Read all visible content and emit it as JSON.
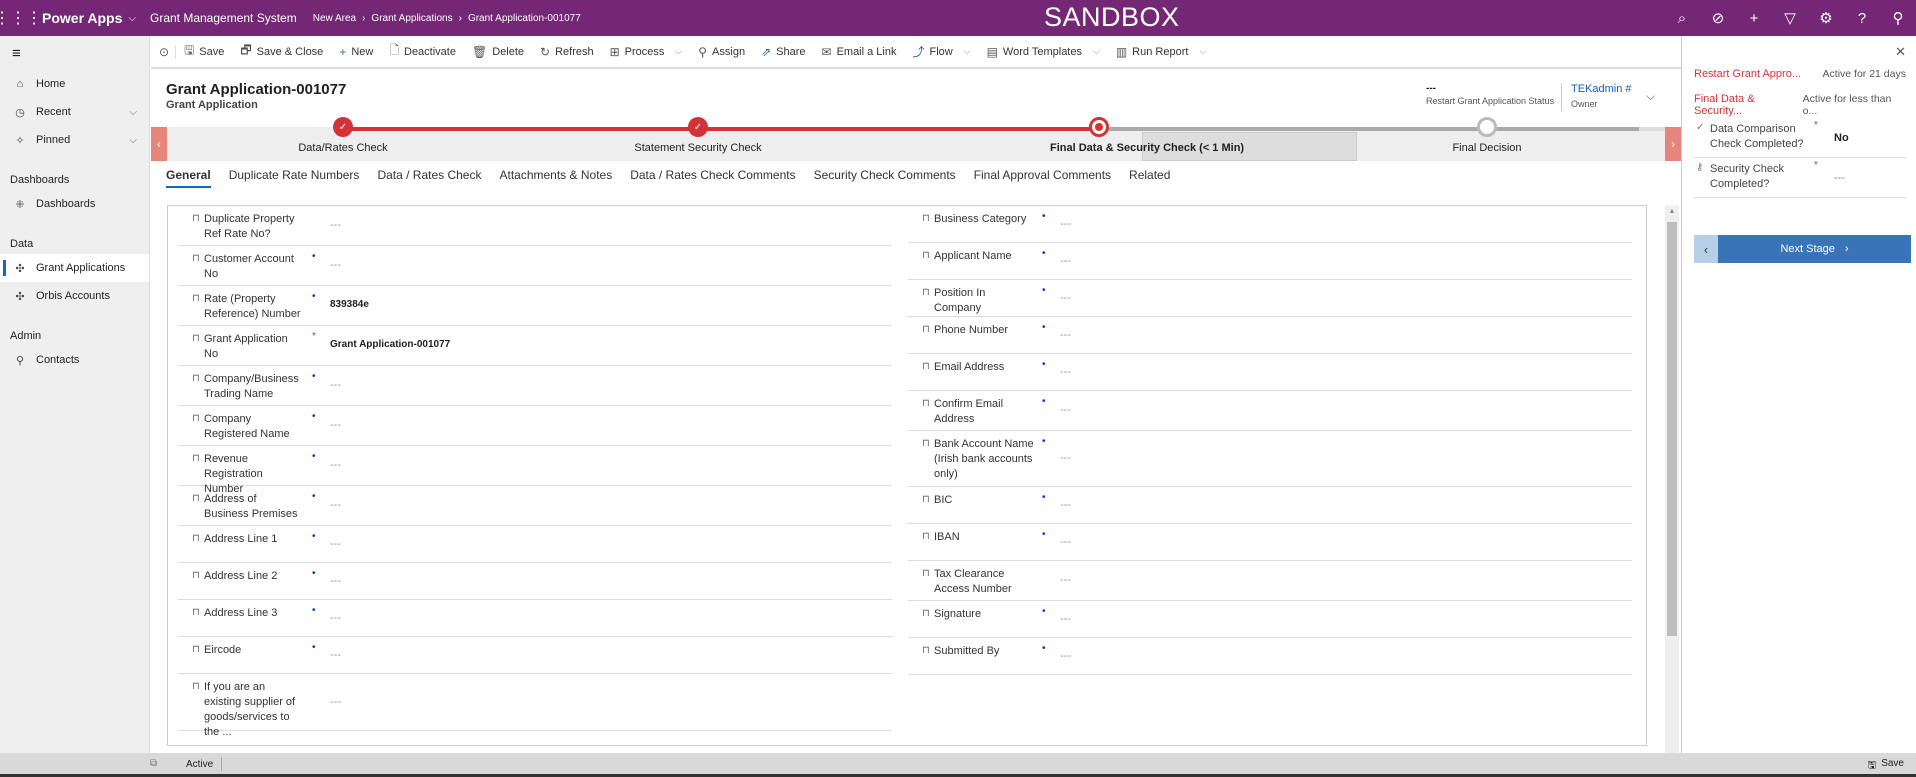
{
  "topbar": {
    "app_name": "Power Apps",
    "system_name": "Grant Management System",
    "breadcrumb": [
      "New Area",
      "Grant Applications",
      "Grant Application-001077"
    ],
    "environment_banner": "SANDBOX",
    "icons": [
      "search-icon",
      "assistant-icon",
      "add-icon",
      "filter-icon",
      "settings-icon",
      "help-icon",
      "user-icon"
    ]
  },
  "sidebar": {
    "items": [
      {
        "label": "Home",
        "icon": "home-icon"
      },
      {
        "label": "Recent",
        "icon": "clock-icon",
        "expandable": true
      },
      {
        "label": "Pinned",
        "icon": "pin-icon",
        "expandable": true
      }
    ],
    "groups": [
      {
        "title": "Dashboards",
        "items": [
          {
            "label": "Dashboards",
            "icon": "dashboard-icon"
          }
        ]
      },
      {
        "title": "Data",
        "items": [
          {
            "label": "Grant Applications",
            "icon": "entity-icon",
            "active": true
          },
          {
            "label": "Orbis Accounts",
            "icon": "entity-icon"
          }
        ]
      },
      {
        "title": "Admin",
        "items": [
          {
            "label": "Contacts",
            "icon": "person-icon"
          }
        ]
      }
    ]
  },
  "commands": [
    {
      "label": "Save",
      "icon": "save-icon"
    },
    {
      "label": "Save & Close",
      "icon": "save-close-icon"
    },
    {
      "label": "New",
      "icon": "plus-icon"
    },
    {
      "label": "Deactivate",
      "icon": "deactivate-icon"
    },
    {
      "label": "Delete",
      "icon": "trash-icon"
    },
    {
      "label": "Refresh",
      "icon": "refresh-icon"
    },
    {
      "label": "Process",
      "icon": "process-icon",
      "dropdown": true
    },
    {
      "label": "Assign",
      "icon": "assign-icon"
    },
    {
      "label": "Share",
      "icon": "share-icon"
    },
    {
      "label": "Email a Link",
      "icon": "email-icon"
    },
    {
      "label": "Flow",
      "icon": "flow-icon",
      "dropdown": true
    },
    {
      "label": "Word Templates",
      "icon": "word-icon",
      "dropdown": true
    },
    {
      "label": "Run Report",
      "icon": "report-icon",
      "dropdown": true
    }
  ],
  "header": {
    "title": "Grant Application-001077",
    "entity": "Grant Application",
    "status_value": "---",
    "status_label": "Restart Grant Application Status",
    "owner_value": "TEKadmin #",
    "owner_label": "Owner"
  },
  "process": {
    "stages": [
      {
        "label": "Data/Rates Check",
        "state": "done"
      },
      {
        "label": "Statement Security Check",
        "state": "done"
      },
      {
        "label": "Final Data & Security Check  (< 1 Min)",
        "state": "active"
      },
      {
        "label": "Final Decision",
        "state": "todo"
      }
    ]
  },
  "tabs": [
    "General",
    "Duplicate Rate Numbers",
    "Data / Rates Check",
    "Attachments & Notes",
    "Data / Rates Check Comments",
    "Security Check Comments",
    "Final Approval Comments",
    "Related"
  ],
  "form": {
    "left": [
      {
        "label": "Duplicate Property Ref Rate No?",
        "req": "",
        "value": "---"
      },
      {
        "label": "Customer Account No",
        "req": "rec",
        "value": "---"
      },
      {
        "label": "Rate (Property Reference) Number",
        "req": "rec",
        "value": "839384e"
      },
      {
        "label": "Grant Application No",
        "req": "star",
        "value": "Grant Application-001077"
      },
      {
        "label": "Company/Business Trading Name",
        "req": "rec",
        "value": "---"
      },
      {
        "label": "Company Registered Name",
        "req": "rec",
        "value": "---"
      },
      {
        "label": "Revenue Registration Number",
        "req": "rec",
        "value": "---"
      },
      {
        "label": "Address of Business Premises",
        "req": "rec",
        "value": "---"
      },
      {
        "label": "Address Line 1",
        "req": "rec",
        "value": "---"
      },
      {
        "label": "Address Line 2",
        "req": "rec",
        "value": "---"
      },
      {
        "label": "Address Line 3",
        "req": "rec",
        "value": "---"
      },
      {
        "label": "Eircode",
        "req": "rec",
        "value": "---"
      },
      {
        "label": "If you are an existing supplier of goods/services to the ...",
        "req": "",
        "value": "---"
      }
    ],
    "right": [
      {
        "label": "Business Category",
        "req": "rec",
        "value": "---"
      },
      {
        "label": "Applicant Name",
        "req": "rec",
        "value": "---"
      },
      {
        "label": "Position In Company",
        "req": "rec",
        "value": "---"
      },
      {
        "label": "Phone Number",
        "req": "rec",
        "value": "---"
      },
      {
        "label": "Email Address",
        "req": "rec",
        "value": "---"
      },
      {
        "label": "Confirm Email Address",
        "req": "rec",
        "value": "---"
      },
      {
        "label": "Bank Account Name (Irish bank accounts only)",
        "req": "rec",
        "value": "---"
      },
      {
        "label": "BIC",
        "req": "rec",
        "value": "---"
      },
      {
        "label": "IBAN",
        "req": "rec",
        "value": "---"
      },
      {
        "label": "Tax Clearance Access Number",
        "req": "",
        "value": "---"
      },
      {
        "label": "Signature",
        "req": "rec",
        "value": "---"
      },
      {
        "label": "Submitted By",
        "req": "rec",
        "value": "---"
      }
    ]
  },
  "panel": {
    "processes": [
      {
        "name": "Restart Grant Appro...",
        "status": "Active for 21 days"
      },
      {
        "name": "Final Data & Security...",
        "status": "Active for less than o..."
      }
    ],
    "fields": [
      {
        "label": "Data Comparison Check Completed?",
        "icon": "check-icon",
        "value": "No"
      },
      {
        "label": "Security Check Completed?",
        "icon": "key-icon",
        "value": "---"
      }
    ],
    "next_stage_label": "Next Stage"
  },
  "statusbar": {
    "status": "Active",
    "save_label": "Save"
  }
}
